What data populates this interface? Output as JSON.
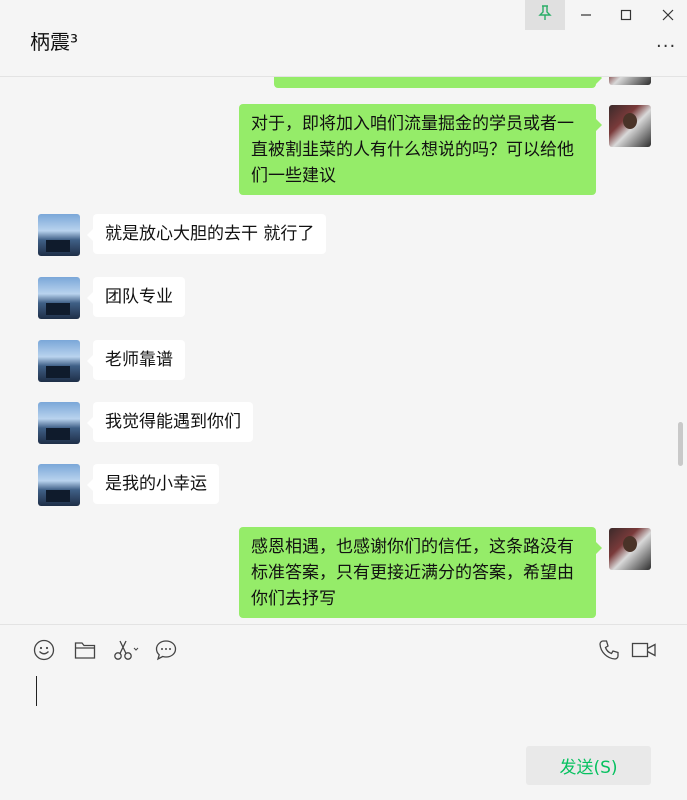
{
  "window": {
    "title": "柄震³",
    "controls": {
      "pin": "pin-icon",
      "minimize": "minimize-icon",
      "maximize": "maximize-icon",
      "close": "close-icon"
    },
    "more_label": "···"
  },
  "messages": [
    {
      "from": "self",
      "text": ""
    },
    {
      "from": "self",
      "text": "对于，即将加入咱们流量掘金的学员或者一直被割韭菜的人有什么想说的吗？可以给他们一些建议"
    },
    {
      "from": "other",
      "text": "就是放心大胆的去干 就行了"
    },
    {
      "from": "other",
      "text": "团队专业"
    },
    {
      "from": "other",
      "text": "老师靠谱"
    },
    {
      "from": "other",
      "text": "我觉得能遇到你们"
    },
    {
      "from": "other",
      "text": "是我的小幸运"
    },
    {
      "from": "self",
      "text": "感恩相遇，也感谢你们的信任，这条路没有标准答案，只有更接近满分的答案，希望由你们去抒写"
    }
  ],
  "toolbar": {
    "emoji": "emoji-icon",
    "folder": "folder-icon",
    "screenshot": "scissors-icon",
    "chat_history": "chat-bubble-icon",
    "voice_call": "phone-icon",
    "video_call": "video-icon"
  },
  "input": {
    "value": ""
  },
  "send_button": {
    "label": "发送(S)"
  },
  "colors": {
    "self_bubble": "#95ec69",
    "other_bubble": "#ffffff",
    "send_text": "#07c160",
    "background": "#f5f5f5"
  }
}
